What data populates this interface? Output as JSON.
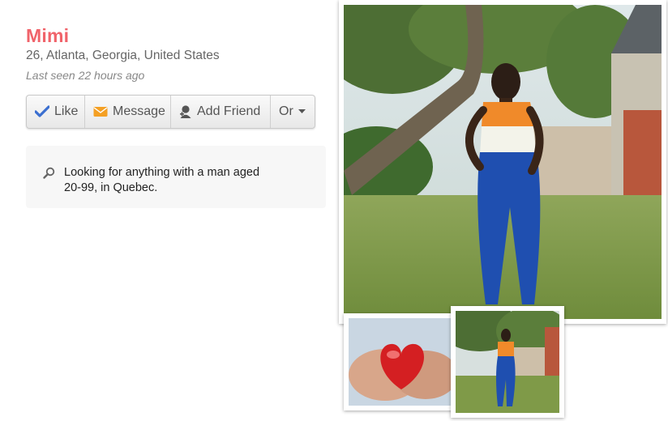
{
  "profile": {
    "name": "Mimi",
    "location": "26, Atlanta, Georgia, United States",
    "last_seen": "Last seen 22 hours ago"
  },
  "actions": {
    "like": "Like",
    "message": "Message",
    "add_friend": "Add Friend",
    "more": "Or"
  },
  "looking_for": {
    "text": "Looking for anything with a man aged 20-99, in Quebec."
  },
  "colors": {
    "name": "#f0636a",
    "like_check": "#3b6fd0",
    "message_envelope": "#f4a024"
  },
  "icons": [
    "check-icon",
    "envelope-icon",
    "add-friend-icon",
    "caret-down-icon",
    "search-icon"
  ]
}
